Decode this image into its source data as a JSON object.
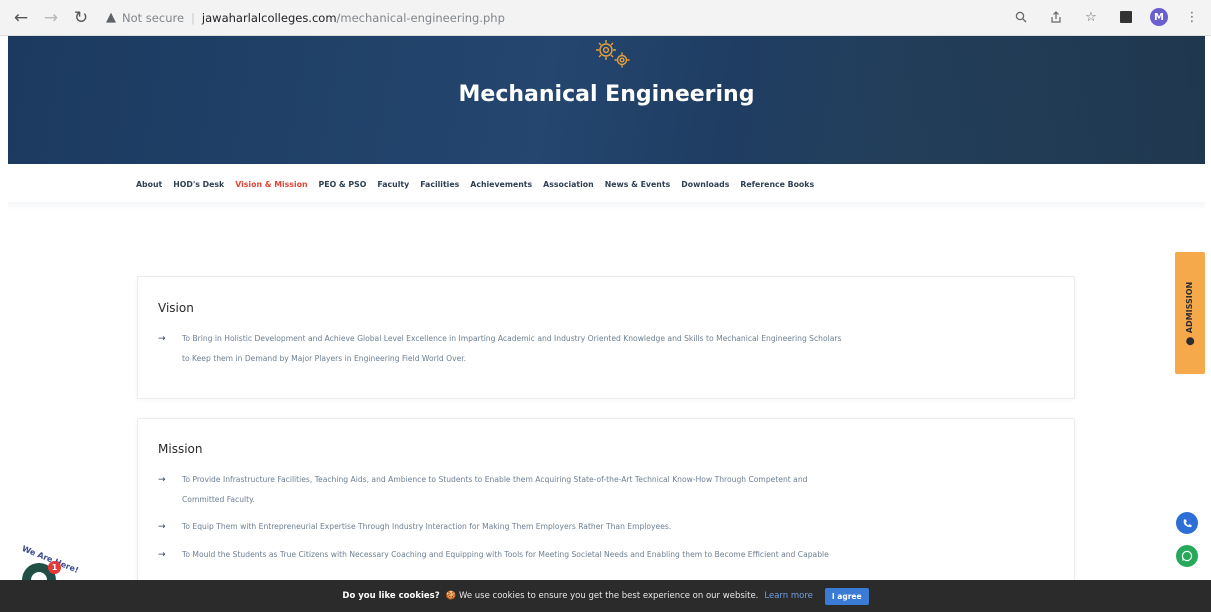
{
  "browser": {
    "security_label": "Not secure",
    "url_host": "jawaharlalcolleges.com",
    "url_path": "/mechanical-engineering.php",
    "profile_initial": "M"
  },
  "hero": {
    "title": "Mechanical Engineering"
  },
  "tabs": [
    {
      "label": "About",
      "active": false
    },
    {
      "label": "HOD's Desk",
      "active": false
    },
    {
      "label": "Vision & Mission",
      "active": true
    },
    {
      "label": "PEO & PSO",
      "active": false
    },
    {
      "label": "Faculty",
      "active": false
    },
    {
      "label": "Facilities",
      "active": false
    },
    {
      "label": "Achievements",
      "active": false
    },
    {
      "label": "Association",
      "active": false
    },
    {
      "label": "News & Events",
      "active": false
    },
    {
      "label": "Downloads",
      "active": false
    },
    {
      "label": "Reference Books",
      "active": false
    }
  ],
  "vision": {
    "heading": "Vision",
    "item_1_line_1": "To Bring in Holistic Development and Achieve Global Level Excellence in Imparting Academic and Industry Oriented Knowledge and Skills to Mechanical Engineering Scholars",
    "item_1_line_2": "to Keep them in Demand by Major Players in Engineering Field World Over."
  },
  "mission": {
    "heading": "Mission",
    "item_1_line_1": "To Provide Infrastructure Facilities, Teaching Aids, and Ambience to Students to Enable them Acquiring State-of-the-Art Technical Know-How Through Competent and",
    "item_1_line_2": "Committed Faculty.",
    "item_2": "To Equip Them with Entrepreneurial Expertise Through Industry Interaction for Making Them Employers Rather Than Employees.",
    "item_3_line_1": "To Mould the Students as True Citizens with Necessary Coaching and Equipping with Tools for Meeting Societal Needs and Enabling them to Become Efficient and Capable"
  },
  "side": {
    "admission_label": "ADMISSION"
  },
  "chat": {
    "badge_count": "1",
    "tag": "We Are Here!"
  },
  "cookie": {
    "question": "Do you like cookies?",
    "message": "🍪 We use cookies to ensure you get the best experience on our website.",
    "learn_more": "Learn more",
    "agree": "I agree"
  },
  "icons": {
    "back": "back-arrow-icon",
    "forward": "forward-arrow-icon",
    "reload": "reload-icon",
    "warning": "warning-icon",
    "zoom": "zoom-icon",
    "share": "share-icon",
    "bookmark": "star-icon",
    "gear": "gear-icon",
    "phone": "phone-icon",
    "whatsapp": "whatsapp-icon"
  },
  "colors": {
    "hero_bg": "#1f3d62",
    "active_tab": "#e0453b",
    "admission_bg": "#f6a94b",
    "call_btn": "#2d6fd6",
    "whatsapp_btn": "#26a95a",
    "cookie_bg": "#2b2b2b",
    "agree_btn": "#3a7bd5"
  }
}
